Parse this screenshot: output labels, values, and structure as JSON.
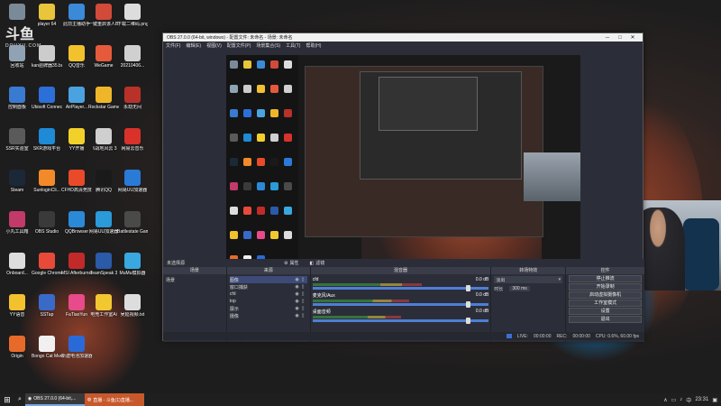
{
  "watermark": {
    "logo_text": "斗鱼",
    "sub": "DOUYU.COM"
  },
  "desktop_icons": [
    {
      "label": "",
      "color": "#7a8a99"
    },
    {
      "label": "player 64",
      "color": "#e8c53a"
    },
    {
      "label": "此前主播助手",
      "color": "#3a8ad8"
    },
    {
      "label": "一键重启该人BIOS",
      "color": "#d24a3a"
    },
    {
      "label": "下载二维码.png",
      "color": "#dddddd"
    },
    {
      "label": "回收站",
      "color": "#8fa3b5"
    },
    {
      "label": "kan验牌器35.bat",
      "color": "#cccccc"
    },
    {
      "label": "QQ音乐",
      "color": "#f2c12e"
    },
    {
      "label": "WeGame",
      "color": "#e65a3c"
    },
    {
      "label": "20210406...",
      "color": "#d0d0d0"
    },
    {
      "label": "控制面板",
      "color": "#3a7ad0"
    },
    {
      "label": "Ubisoft Connect",
      "color": "#2d6fd8"
    },
    {
      "label": "AirPlayer...",
      "color": "#4aa3e0"
    },
    {
      "label": "Rockstar Games...",
      "color": "#f0b62a"
    },
    {
      "label": "永劫无间",
      "color": "#b8322a"
    },
    {
      "label": "SSR实验室",
      "color": "#5a5a5a"
    },
    {
      "label": "SKR游戏平台",
      "color": "#1f8ad6"
    },
    {
      "label": "YY开播",
      "color": "#f2d02a"
    },
    {
      "label": "《战地风云 3",
      "color": "#cfcfcf"
    },
    {
      "label": "网易云音乐",
      "color": "#d8322a"
    },
    {
      "label": "Steam",
      "color": "#1b2838"
    },
    {
      "label": "SunloginCli...",
      "color": "#f28a2a"
    },
    {
      "label": "CFHD高清竞技大区",
      "color": "#e84a2a"
    },
    {
      "label": "腾讯QQ",
      "color": "#1a1a1a"
    },
    {
      "label": "网易UU加速器",
      "color": "#2a7ad8"
    },
    {
      "label": "小丸工具箱",
      "color": "#c23a6a"
    },
    {
      "label": "OBS Studio",
      "color": "#3a3a3a"
    },
    {
      "label": "QQBrowser",
      "color": "#2a8ad8"
    },
    {
      "label": "网易UU加速器",
      "color": "#2a9ad8"
    },
    {
      "label": "Battlestate Games L...",
      "color": "#4a4a4a"
    },
    {
      "label": "Onboard...",
      "color": "#dddddd"
    },
    {
      "label": "Google Chrome",
      "color": "#e84a3a"
    },
    {
      "label": "MSI Afterburner",
      "color": "#c22a2a"
    },
    {
      "label": "TeamSpeak 3",
      "color": "#2a5aa8"
    },
    {
      "label": "MuMu模拟器",
      "color": "#3aa8e0"
    },
    {
      "label": "YY语音",
      "color": "#f2c12e"
    },
    {
      "label": "SSTap",
      "color": "#3a6ac8"
    },
    {
      "label": "FaTiaoYun",
      "color": "#e84a8a"
    },
    {
      "label": "电竞工作室Ai",
      "color": "#f2c830"
    },
    {
      "label": "吴延视频.txt",
      "color": "#dddddd"
    },
    {
      "label": "Origin",
      "color": "#e86a2a"
    },
    {
      "label": "Bongo Cat Mver.exe",
      "color": "#f0f0f0"
    },
    {
      "label": "新建电池加速器",
      "color": "#2a6ad8"
    }
  ],
  "obs": {
    "title": "OBS 27.0.0 (64-bit, windows) - 配置文件: 未命名 - 场景: 未命名",
    "menu": [
      "文件(F)",
      "编辑(E)",
      "视图(V)",
      "配置文件(P)",
      "场景集合(S)",
      "工具(T)",
      "帮助(H)"
    ],
    "tab_row": [
      "未选择源",
      "属性",
      "滤镜"
    ],
    "docks": {
      "scenes": {
        "title": "场景",
        "items": [
          "场景"
        ]
      },
      "sources": {
        "title": "来源",
        "items": [
          "图像",
          "窗口捕获",
          "cfd",
          "top",
          "展示",
          "摄像"
        ]
      },
      "mixer": {
        "title": "混音器",
        "tracks": [
          {
            "name": "cfd",
            "db": "0.0 dB",
            "level": 0.62
          },
          {
            "name": "麦克风/Aux",
            "db": "0.0 dB",
            "level": 0.55
          },
          {
            "name": "桌面音频",
            "db": "0.0 dB",
            "level": 0.5
          }
        ]
      },
      "transitions": {
        "title": "转场特效",
        "type": "淡出",
        "duration_label": "时长",
        "duration_value": "300 ms"
      },
      "controls": {
        "title": "控件",
        "buttons": [
          "停止推流",
          "开始录制",
          "启动虚拟摄像机",
          "工作室模式",
          "设置",
          "退出"
        ]
      }
    },
    "status": {
      "live_label": "LIVE:",
      "live_time": "00:00:00",
      "rec_label": "REC:",
      "rec_time": "00:00:00",
      "cpu": "CPU: 0.6%, 60.00 fps"
    }
  },
  "taskbar": {
    "start_icon": "windows-logo-icon",
    "items": [
      {
        "label": "OBS 27.0.0 (64-bit,...",
        "icon": "obs-icon"
      },
      {
        "label": "直播 - 斗鱼(1)直播...",
        "icon": "browser-icon"
      }
    ],
    "clock": "23:31"
  }
}
